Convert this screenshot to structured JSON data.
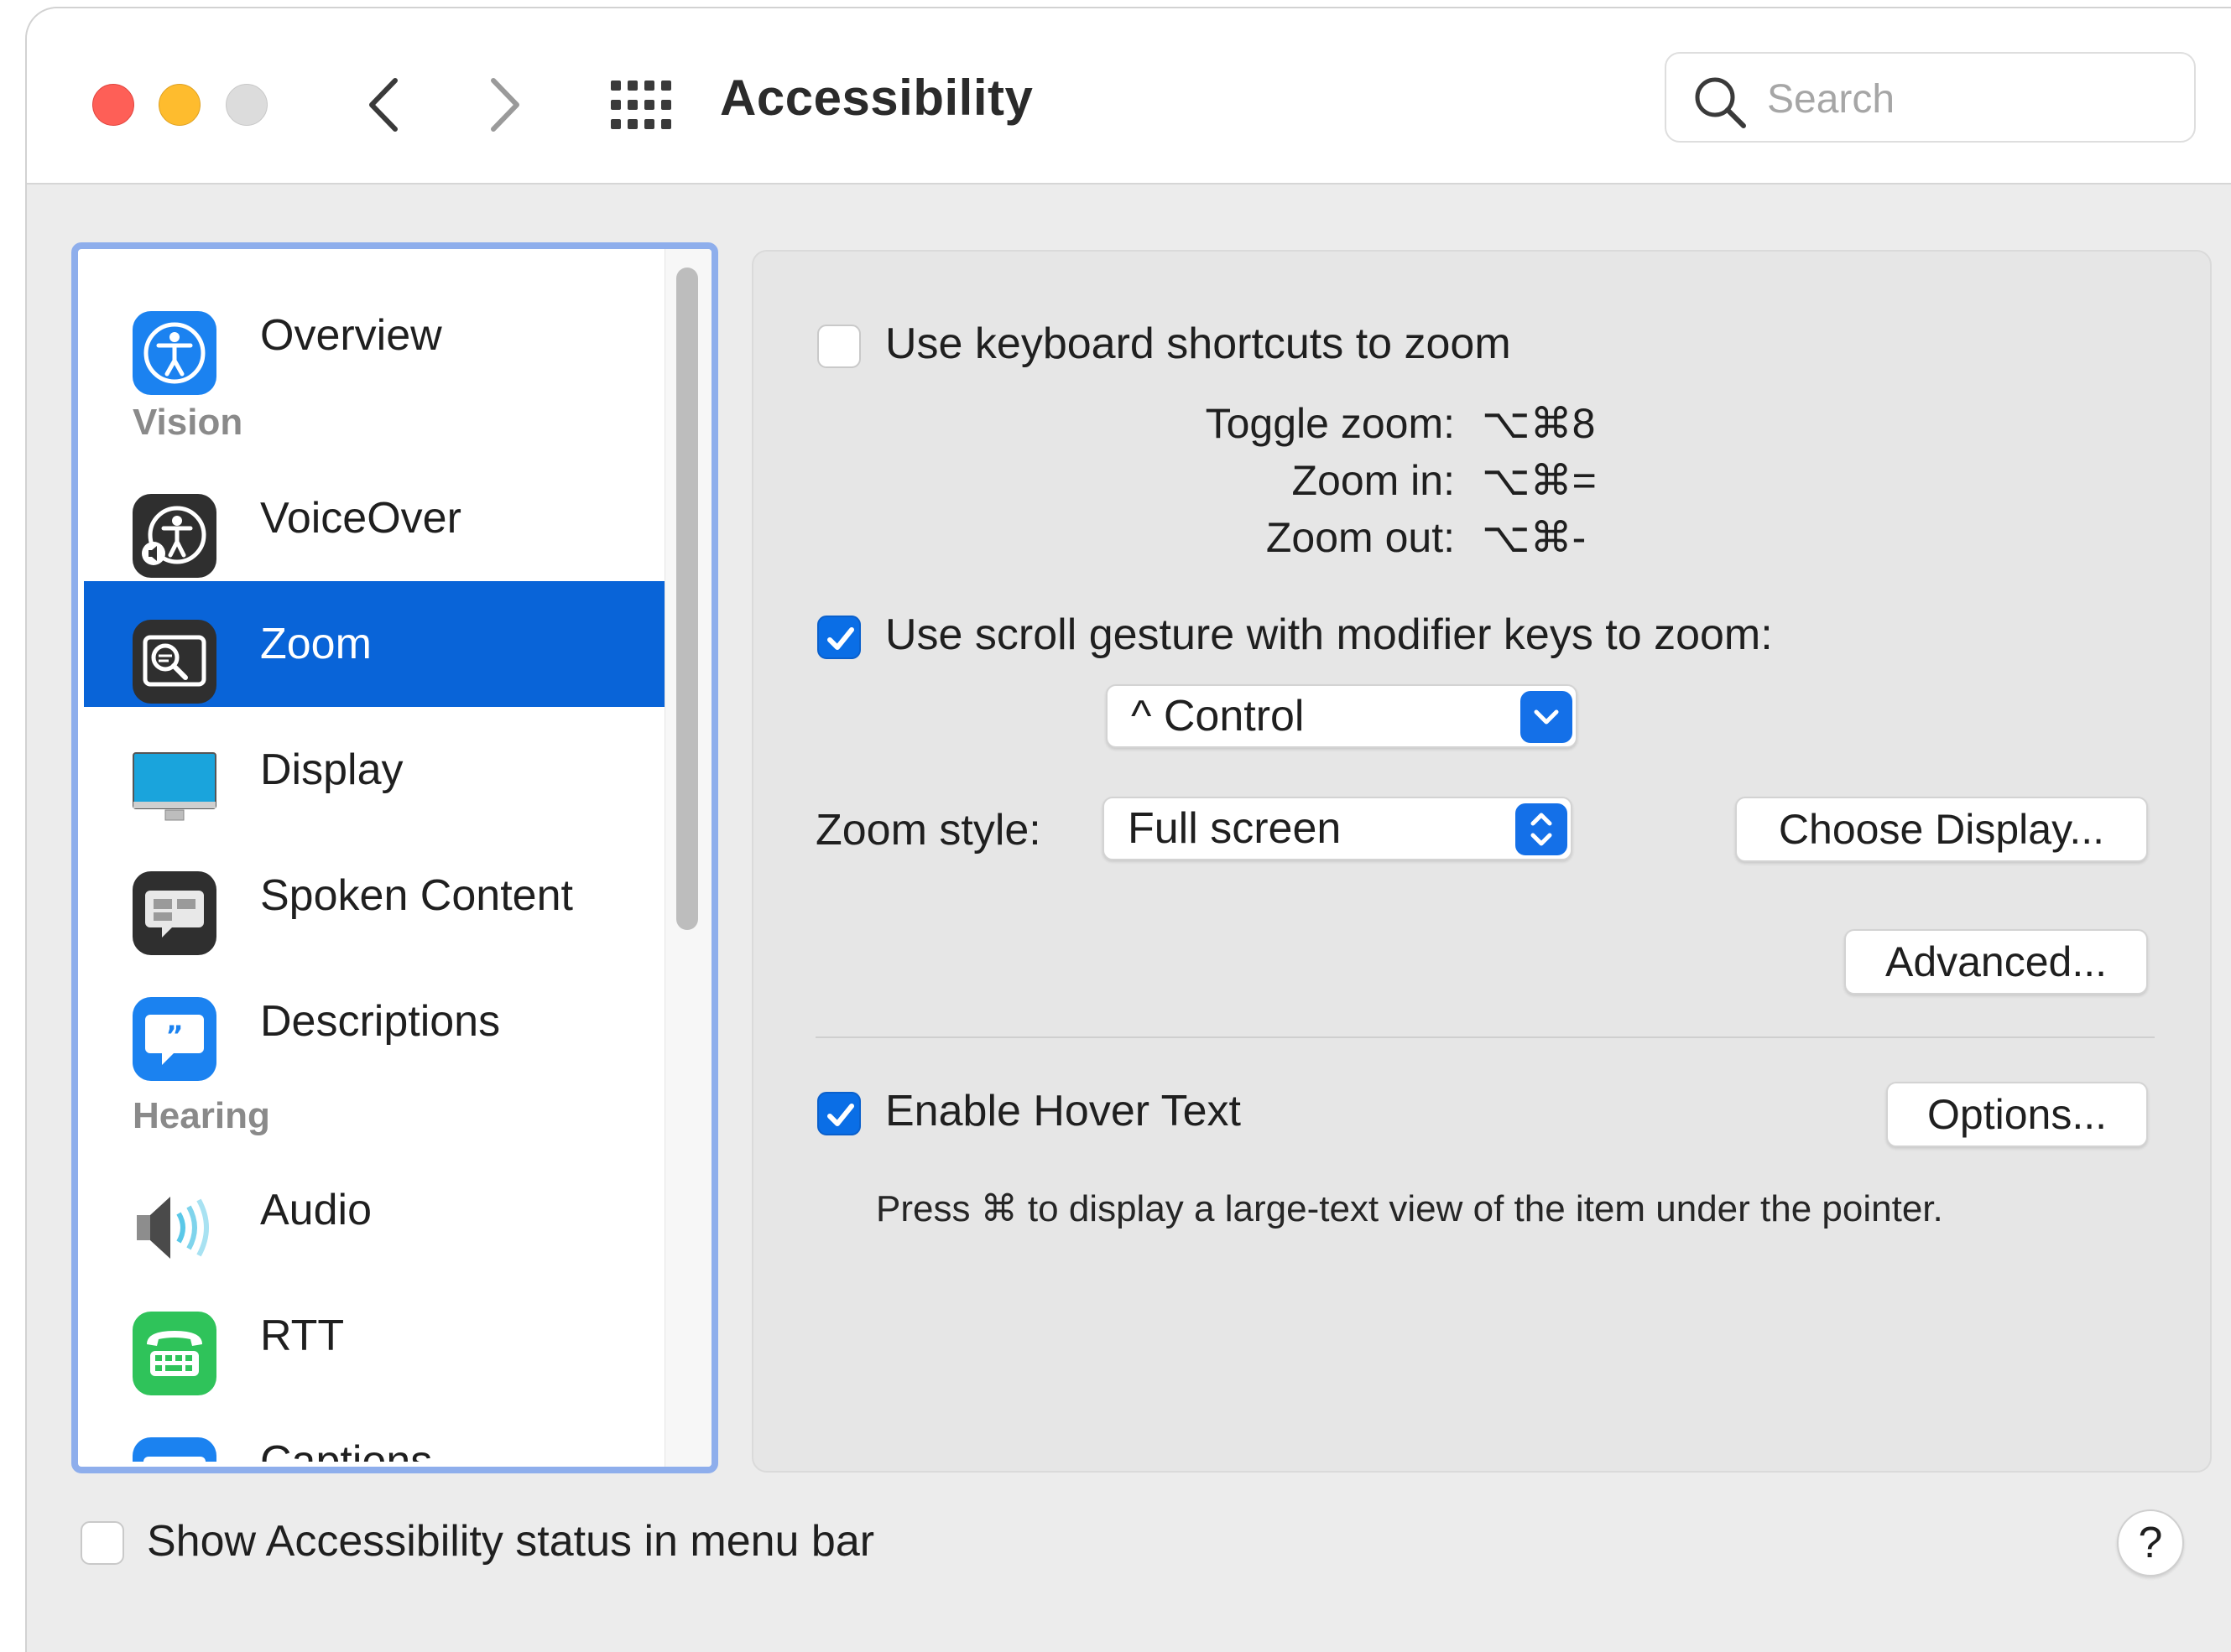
{
  "window": {
    "title": "Accessibility",
    "search": {
      "placeholder": "Search",
      "value": ""
    }
  },
  "sidebar": {
    "items": [
      {
        "type": "item",
        "label": "Overview",
        "icon": "accessibility-icon",
        "selected": false
      },
      {
        "type": "section",
        "label": "Vision"
      },
      {
        "type": "item",
        "label": "VoiceOver",
        "icon": "voiceover-icon",
        "selected": false
      },
      {
        "type": "item",
        "label": "Zoom",
        "icon": "zoom-icon",
        "selected": true
      },
      {
        "type": "item",
        "label": "Display",
        "icon": "display-icon",
        "selected": false
      },
      {
        "type": "item",
        "label": "Spoken Content",
        "icon": "spoken-content-icon",
        "selected": false
      },
      {
        "type": "item",
        "label": "Descriptions",
        "icon": "descriptions-icon",
        "selected": false
      },
      {
        "type": "section",
        "label": "Hearing"
      },
      {
        "type": "item",
        "label": "Audio",
        "icon": "speaker-icon",
        "selected": false
      },
      {
        "type": "item",
        "label": "RTT",
        "icon": "rtt-icon",
        "selected": false
      },
      {
        "type": "item",
        "label": "Captions",
        "icon": "captions-icon",
        "selected": false
      }
    ]
  },
  "zoom": {
    "keyboard_shortcuts": {
      "label": "Use keyboard shortcuts to zoom",
      "checked": false
    },
    "shortcuts": [
      {
        "label": "Toggle zoom:",
        "keys": "⌥⌘8"
      },
      {
        "label": "Zoom in:",
        "keys": "⌥⌘="
      },
      {
        "label": "Zoom out:",
        "keys": "⌥⌘-"
      }
    ],
    "scroll_gesture": {
      "label": "Use scroll gesture with modifier keys to zoom:",
      "checked": true
    },
    "modifier_popup": {
      "value": "^ Control"
    },
    "zoom_style": {
      "label": "Zoom style:",
      "value": "Full screen"
    },
    "choose_display_button": "Choose Display...",
    "advanced_button": "Advanced...",
    "hover_text": {
      "label": "Enable Hover Text",
      "checked": true
    },
    "options_button": "Options...",
    "hover_hint": "Press ⌘ to display a large-text view of the item under the pointer."
  },
  "footer": {
    "status_menu": {
      "label": "Show Accessibility status in menu bar",
      "checked": false
    },
    "help_label": "?"
  },
  "colors": {
    "accent": "#0964d8",
    "checkbox_on": "#0a6ee6",
    "close": "#fe5f57",
    "minimize": "#febc2e",
    "zoom_inactive": "#dcdcdc"
  }
}
